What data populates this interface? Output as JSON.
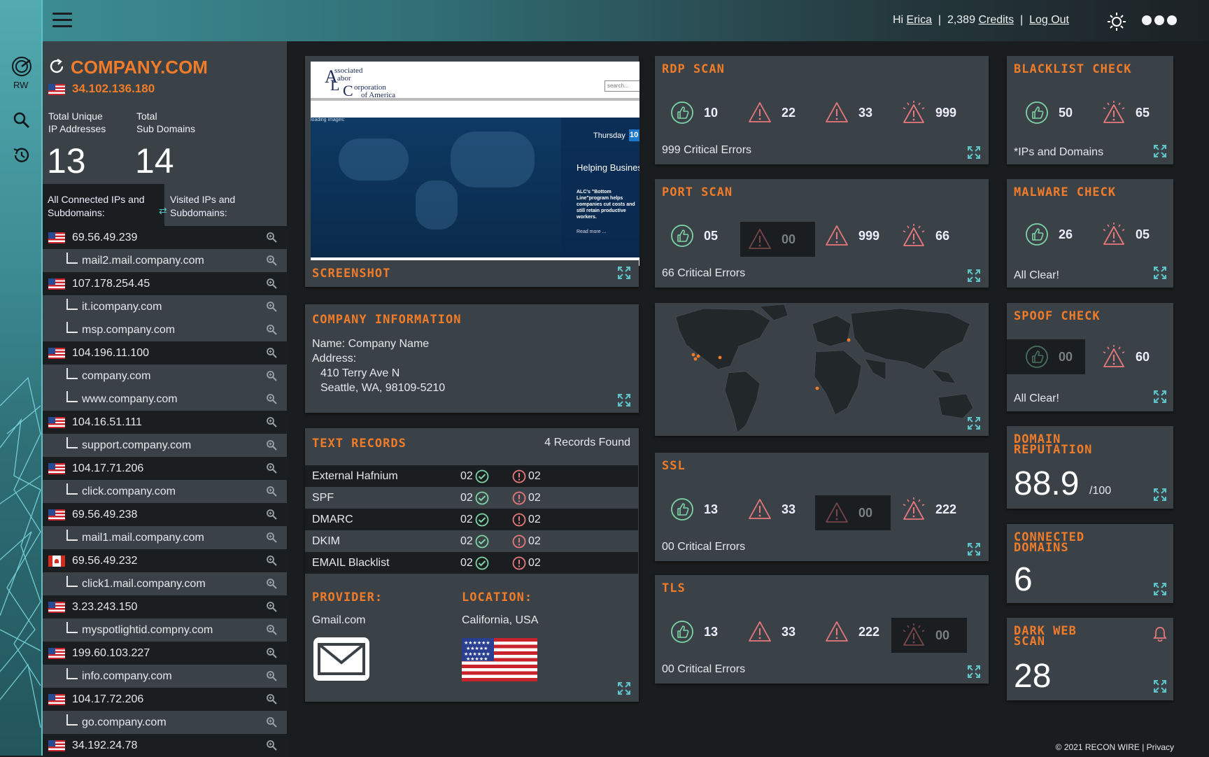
{
  "header": {
    "greeting": "Hi",
    "user": "Erica",
    "credits_count": "2,389",
    "credits_label": "Credits",
    "logout": "Log Out",
    "sep": "|"
  },
  "rail": {
    "logo_text": "RW"
  },
  "sidebar": {
    "domain": "COMPANY.COM",
    "ip": "34.102.136.180",
    "stat1_label": "Total Unique\nIP Addresses",
    "stat1_value": "13",
    "stat2_label": "Total\nSub Domains",
    "stat2_value": "14",
    "tab1": "All Connected IPs and Subdomains:",
    "tab2": "Visited IPs and Subdomains:",
    "rows": [
      {
        "type": "ip",
        "text": "69.56.49.239",
        "flag": "us"
      },
      {
        "type": "sub",
        "text": "mail2.mail.company.com"
      },
      {
        "type": "ip",
        "text": "107.178.254.45",
        "flag": "us"
      },
      {
        "type": "sub",
        "text": "it.icompany.com"
      },
      {
        "type": "sub",
        "text": "msp.company.com"
      },
      {
        "type": "ip",
        "text": "104.196.11.100",
        "flag": "us"
      },
      {
        "type": "sub",
        "text": "company.com"
      },
      {
        "type": "sub",
        "text": "www.company.com"
      },
      {
        "type": "ip",
        "text": "104.16.51.111",
        "flag": "us"
      },
      {
        "type": "sub",
        "text": "support.company.com"
      },
      {
        "type": "ip",
        "text": "104.17.71.206",
        "flag": "us"
      },
      {
        "type": "sub",
        "text": "click.company.com"
      },
      {
        "type": "ip",
        "text": "69.56.49.238",
        "flag": "us"
      },
      {
        "type": "sub",
        "text": "mail1.mail.company.com"
      },
      {
        "type": "ip",
        "text": "69.56.49.232",
        "flag": "ca"
      },
      {
        "type": "sub",
        "text": "click1.mail.company.com"
      },
      {
        "type": "ip",
        "text": "3.23.243.150",
        "flag": "us"
      },
      {
        "type": "sub",
        "text": "myspotlightid.compny.com"
      },
      {
        "type": "ip",
        "text": "199.60.103.227",
        "flag": "us"
      },
      {
        "type": "sub",
        "text": "info.company.com"
      },
      {
        "type": "ip",
        "text": "104.17.72.206",
        "flag": "us"
      },
      {
        "type": "sub",
        "text": "go.company.com"
      },
      {
        "type": "ip",
        "text": "34.192.24.78",
        "flag": "us"
      }
    ]
  },
  "screenshot_card": {
    "title": "SCREENSHOT",
    "site_name_l1": "ssociated",
    "site_name_l2": "abor",
    "site_name_l3": "orporation",
    "site_name_l4": "of America",
    "search_placeholder": "search...",
    "loading": "loading images:",
    "day": "Thursday",
    "date": "10",
    "headline": "Helping Busines",
    "body": "ALC's \"Bottom Line\"program helps companies cut costs and still retain productive workers.",
    "read_more": "Read more ..."
  },
  "company_info": {
    "title": "COMPANY INFORMATION",
    "name": "Name: Company Name",
    "address_label": "Address:",
    "address1": "410 Terry Ave N",
    "address2": "Seattle, WA, 98109-5210"
  },
  "text_records": {
    "title": "TEXT RECORDS",
    "found": "4 Records Found",
    "rows": [
      {
        "name": "External Hafnium",
        "ok": "02",
        "err": "02"
      },
      {
        "name": "SPF",
        "ok": "02",
        "err": "02"
      },
      {
        "name": "DMARC",
        "ok": "02",
        "err": "02"
      },
      {
        "name": "DKIM",
        "ok": "02",
        "err": "02"
      },
      {
        "name": "EMAIL Blacklist",
        "ok": "02",
        "err": "02"
      }
    ],
    "provider_label": "PROVIDER:",
    "provider": "Gmail.com",
    "location_label": "LOCATION:",
    "location": "California, USA"
  },
  "rdp": {
    "title": "RDP SCAN",
    "v1": "10",
    "v2": "22",
    "v3": "33",
    "v4": "999",
    "foot": "999 Critical Errors"
  },
  "port": {
    "title": "PORT SCAN",
    "v1": "05",
    "v2": "00",
    "v3": "999",
    "v4": "66",
    "foot": "66 Critical Errors"
  },
  "ssl": {
    "title": "SSL",
    "v1": "13",
    "v2": "33",
    "v3": "00",
    "v4": "222",
    "foot": "00 Critical Errors"
  },
  "tls": {
    "title": "TLS",
    "v1": "13",
    "v2": "33",
    "v3": "222",
    "v4": "00",
    "foot": "00 Critical Errors"
  },
  "blacklist": {
    "title": "BLACKLIST CHECK",
    "v1": "50",
    "v2": "65",
    "foot": "*IPs and Domains"
  },
  "malware": {
    "title": "MALWARE CHECK",
    "v1": "26",
    "v2": "05",
    "foot": "All Clear!"
  },
  "spoof": {
    "title": "SPOOF CHECK",
    "v1": "00",
    "v2": "60",
    "foot": "All Clear!"
  },
  "reputation": {
    "title": "DOMAIN REPUTATION",
    "value": "88.9",
    "suffix": "/100"
  },
  "connected": {
    "title": "CONNECTED DOMAINS",
    "value": "6"
  },
  "darkweb": {
    "title": "DARK WEB SCAN",
    "value": "28"
  },
  "footer": {
    "copyright": "© 2021 RECON WIRE |",
    "privacy": "Privacy"
  },
  "colors": {
    "accent": "#f07c2a",
    "teal": "#5ec3c9",
    "ok": "#7fd4a6",
    "warn": "#e8787c",
    "card": "#3a4248",
    "dark": "#1b1e20"
  },
  "icons": [
    "hamburger-icon",
    "sun-icon",
    "more-icon",
    "logo-icon",
    "search-icon",
    "history-icon",
    "refresh-icon",
    "magnify-icon",
    "thumbs-up-icon",
    "warning-icon",
    "critical-icon",
    "expand-icon",
    "check-icon",
    "alert-icon",
    "mail-icon",
    "bell-icon"
  ]
}
